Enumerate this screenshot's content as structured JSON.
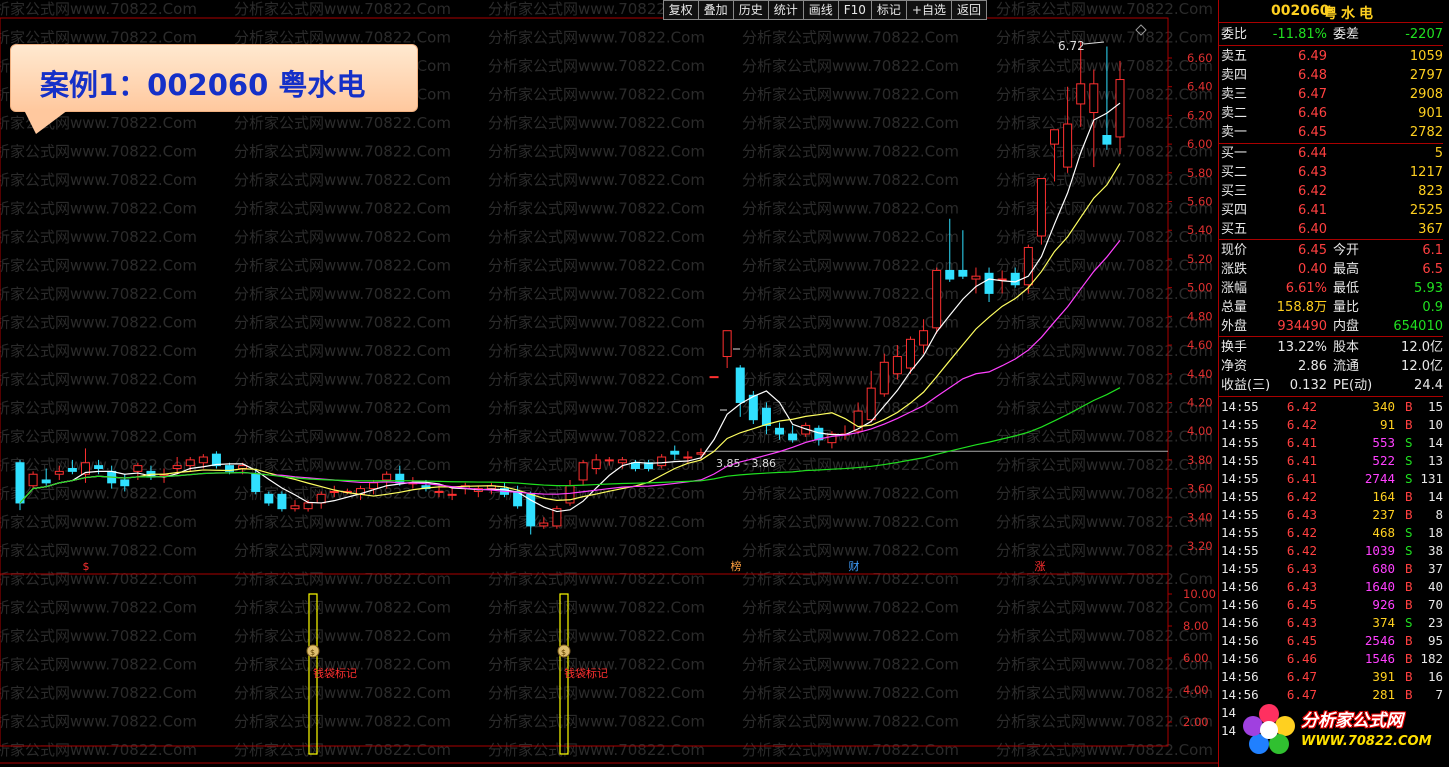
{
  "toolbar": [
    "复权",
    "叠加",
    "历史",
    "统计",
    "画线",
    "F10",
    "标记",
    "+自选",
    "返回"
  ],
  "callout": "案例1：002060 粤水电",
  "watermark": "分析家公式网www.70822.Com",
  "price_axis": [
    "6.60",
    "6.40",
    "6.20",
    "6.00",
    "5.80",
    "5.60",
    "5.40",
    "5.20",
    "5.00",
    "4.80",
    "4.60",
    "4.40",
    "4.20",
    "4.00",
    "3.80",
    "3.60",
    "3.40",
    "3.20"
  ],
  "indicator_axis": [
    "10.00",
    "8.00",
    "6.00",
    "4.00",
    "2.00"
  ],
  "annotations": {
    "high_label": "6.72",
    "range_label": "3.85 - 3.86",
    "event_marks": [
      "$",
      "榜",
      "财",
      "涨"
    ],
    "signal_label_1": "钱袋标记",
    "signal_label_2": "钱袋标记"
  },
  "colors": {
    "up": "#ff3030",
    "down": "#30e0ff",
    "ma5": "#ffffff",
    "ma10": "#ffff60",
    "ma20": "#ff40ff",
    "ma60": "#20e020",
    "signal": "#ffff00"
  },
  "header": {
    "code": "002060",
    "name": "粤水电"
  },
  "quote_top": {
    "label1": "委比",
    "val1": "-11.81%",
    "label2": "委差",
    "val2": "-2207"
  },
  "asks": [
    {
      "label": "卖五",
      "price": "6.49",
      "vol": "1059"
    },
    {
      "label": "卖四",
      "price": "6.48",
      "vol": "2797"
    },
    {
      "label": "卖三",
      "price": "6.47",
      "vol": "2908"
    },
    {
      "label": "卖二",
      "price": "6.46",
      "vol": "901"
    },
    {
      "label": "卖一",
      "price": "6.45",
      "vol": "2782"
    }
  ],
  "bids": [
    {
      "label": "买一",
      "price": "6.44",
      "vol": "5"
    },
    {
      "label": "买二",
      "price": "6.43",
      "vol": "1217"
    },
    {
      "label": "买三",
      "price": "6.42",
      "vol": "823"
    },
    {
      "label": "买四",
      "price": "6.41",
      "vol": "2525"
    },
    {
      "label": "买五",
      "price": "6.40",
      "vol": "367"
    }
  ],
  "stats": [
    {
      "l1": "现价",
      "v1": "6.45",
      "c1": "red",
      "l2": "今开",
      "v2": "6.1",
      "c2": "red"
    },
    {
      "l1": "涨跌",
      "v1": "0.40",
      "c1": "red",
      "l2": "最高",
      "v2": "6.5",
      "c2": "red"
    },
    {
      "l1": "涨幅",
      "v1": "6.61%",
      "c1": "red",
      "l2": "最低",
      "v2": "5.93",
      "c2": "green"
    },
    {
      "l1": "总量",
      "v1": "158.8万",
      "c1": "yellow",
      "l2": "量比",
      "v2": "0.9",
      "c2": "green"
    },
    {
      "l1": "外盘",
      "v1": "934490",
      "c1": "red",
      "l2": "内盘",
      "v2": "654010",
      "c2": "green"
    }
  ],
  "stats2": [
    {
      "l1": "换手",
      "v1": "13.22%",
      "l2": "股本",
      "v2": "12.0亿"
    },
    {
      "l1": "净资",
      "v1": "2.86",
      "l2": "流通",
      "v2": "12.0亿"
    },
    {
      "l1": "收益(三)",
      "v1": "0.132",
      "l2": "PE(动)",
      "v2": "24.4"
    }
  ],
  "ticks": [
    {
      "t": "14:55",
      "p": "6.42",
      "pc": "red",
      "v": "340",
      "vc": "yellow",
      "s": "B",
      "n": "15"
    },
    {
      "t": "14:55",
      "p": "6.42",
      "pc": "red",
      "v": "91",
      "vc": "yellow",
      "s": "B",
      "n": "10"
    },
    {
      "t": "14:55",
      "p": "6.41",
      "pc": "red",
      "v": "553",
      "vc": "magenta",
      "s": "S",
      "n": "14"
    },
    {
      "t": "14:55",
      "p": "6.41",
      "pc": "red",
      "v": "522",
      "vc": "magenta",
      "s": "S",
      "n": "13"
    },
    {
      "t": "14:55",
      "p": "6.41",
      "pc": "red",
      "v": "2744",
      "vc": "magenta",
      "s": "S",
      "n": "131"
    },
    {
      "t": "14:55",
      "p": "6.42",
      "pc": "red",
      "v": "164",
      "vc": "yellow",
      "s": "B",
      "n": "14"
    },
    {
      "t": "14:55",
      "p": "6.43",
      "pc": "red",
      "v": "237",
      "vc": "yellow",
      "s": "B",
      "n": "8"
    },
    {
      "t": "14:55",
      "p": "6.42",
      "pc": "red",
      "v": "468",
      "vc": "yellow",
      "s": "S",
      "n": "18"
    },
    {
      "t": "14:55",
      "p": "6.42",
      "pc": "red",
      "v": "1039",
      "vc": "magenta",
      "s": "S",
      "n": "38"
    },
    {
      "t": "14:55",
      "p": "6.43",
      "pc": "red",
      "v": "680",
      "vc": "magenta",
      "s": "B",
      "n": "37"
    },
    {
      "t": "14:56",
      "p": "6.43",
      "pc": "red",
      "v": "1640",
      "vc": "magenta",
      "s": "B",
      "n": "40"
    },
    {
      "t": "14:56",
      "p": "6.45",
      "pc": "red",
      "v": "926",
      "vc": "magenta",
      "s": "B",
      "n": "70"
    },
    {
      "t": "14:56",
      "p": "6.43",
      "pc": "red",
      "v": "374",
      "vc": "yellow",
      "s": "S",
      "n": "23"
    },
    {
      "t": "14:56",
      "p": "6.45",
      "pc": "red",
      "v": "2546",
      "vc": "magenta",
      "s": "B",
      "n": "95"
    },
    {
      "t": "14:56",
      "p": "6.46",
      "pc": "red",
      "v": "1546",
      "vc": "magenta",
      "s": "B",
      "n": "182"
    },
    {
      "t": "14:56",
      "p": "6.47",
      "pc": "red",
      "v": "391",
      "vc": "yellow",
      "s": "B",
      "n": "16"
    },
    {
      "t": "14:56",
      "p": "6.47",
      "pc": "red",
      "v": "281",
      "vc": "yellow",
      "s": "B",
      "n": "7"
    },
    {
      "t": "14",
      "p": "",
      "pc": "red",
      "v": "",
      "vc": "yellow",
      "s": "",
      "n": ""
    },
    {
      "t": "14",
      "p": "",
      "pc": "red",
      "v": "",
      "vc": "yellow",
      "s": "",
      "n": ""
    }
  ],
  "logo": {
    "text": "分析家公式网",
    "url": "WWW.70822.COM"
  },
  "candles": [
    {
      "o": 3.78,
      "h": 3.8,
      "l": 3.45,
      "c": 3.5
    },
    {
      "o": 3.62,
      "h": 3.72,
      "l": 3.6,
      "c": 3.7
    },
    {
      "o": 3.66,
      "h": 3.74,
      "l": 3.62,
      "c": 3.64
    },
    {
      "o": 3.7,
      "h": 3.76,
      "l": 3.66,
      "c": 3.72
    },
    {
      "o": 3.74,
      "h": 3.8,
      "l": 3.7,
      "c": 3.72
    },
    {
      "o": 3.7,
      "h": 3.88,
      "l": 3.64,
      "c": 3.78
    },
    {
      "o": 3.76,
      "h": 3.8,
      "l": 3.7,
      "c": 3.74
    },
    {
      "o": 3.72,
      "h": 3.76,
      "l": 3.6,
      "c": 3.64
    },
    {
      "o": 3.66,
      "h": 3.7,
      "l": 3.58,
      "c": 3.62
    },
    {
      "o": 3.72,
      "h": 3.78,
      "l": 3.66,
      "c": 3.76
    },
    {
      "o": 3.72,
      "h": 3.76,
      "l": 3.66,
      "c": 3.68
    },
    {
      "o": 3.7,
      "h": 3.74,
      "l": 3.64,
      "c": 3.7
    },
    {
      "o": 3.74,
      "h": 3.82,
      "l": 3.7,
      "c": 3.76
    },
    {
      "o": 3.76,
      "h": 3.82,
      "l": 3.72,
      "c": 3.8
    },
    {
      "o": 3.78,
      "h": 3.84,
      "l": 3.74,
      "c": 3.82
    },
    {
      "o": 3.84,
      "h": 3.86,
      "l": 3.74,
      "c": 3.76
    },
    {
      "o": 3.76,
      "h": 3.78,
      "l": 3.7,
      "c": 3.72
    },
    {
      "o": 3.74,
      "h": 3.78,
      "l": 3.7,
      "c": 3.76
    },
    {
      "o": 3.7,
      "h": 3.74,
      "l": 3.56,
      "c": 3.58
    },
    {
      "o": 3.56,
      "h": 3.58,
      "l": 3.48,
      "c": 3.5
    },
    {
      "o": 3.56,
      "h": 3.58,
      "l": 3.44,
      "c": 3.46
    },
    {
      "o": 3.46,
      "h": 3.52,
      "l": 3.44,
      "c": 3.48
    },
    {
      "o": 3.46,
      "h": 3.52,
      "l": 3.44,
      "c": 3.5
    },
    {
      "o": 3.5,
      "h": 3.58,
      "l": 3.46,
      "c": 3.56
    },
    {
      "o": 3.58,
      "h": 3.62,
      "l": 3.54,
      "c": 3.58
    },
    {
      "o": 3.58,
      "h": 3.6,
      "l": 3.56,
      "c": 3.58
    },
    {
      "o": 3.56,
      "h": 3.62,
      "l": 3.52,
      "c": 3.6
    },
    {
      "o": 3.6,
      "h": 3.66,
      "l": 3.56,
      "c": 3.64
    },
    {
      "o": 3.66,
      "h": 3.72,
      "l": 3.6,
      "c": 3.7
    },
    {
      "o": 3.7,
      "h": 3.76,
      "l": 3.62,
      "c": 3.64
    },
    {
      "o": 3.64,
      "h": 3.68,
      "l": 3.6,
      "c": 3.64
    },
    {
      "o": 3.62,
      "h": 3.66,
      "l": 3.58,
      "c": 3.6
    },
    {
      "o": 3.58,
      "h": 3.62,
      "l": 3.54,
      "c": 3.58
    },
    {
      "o": 3.56,
      "h": 3.6,
      "l": 3.52,
      "c": 3.56
    },
    {
      "o": 3.6,
      "h": 3.64,
      "l": 3.56,
      "c": 3.62
    },
    {
      "o": 3.58,
      "h": 3.62,
      "l": 3.54,
      "c": 3.6
    },
    {
      "o": 3.6,
      "h": 3.64,
      "l": 3.56,
      "c": 3.62
    },
    {
      "o": 3.6,
      "h": 3.64,
      "l": 3.54,
      "c": 3.56
    },
    {
      "o": 3.58,
      "h": 3.62,
      "l": 3.46,
      "c": 3.48
    },
    {
      "o": 3.56,
      "h": 3.58,
      "l": 3.28,
      "c": 3.34
    },
    {
      "o": 3.34,
      "h": 3.4,
      "l": 3.32,
      "c": 3.36
    },
    {
      "o": 3.34,
      "h": 3.48,
      "l": 3.32,
      "c": 3.46
    },
    {
      "o": 3.5,
      "h": 3.66,
      "l": 3.48,
      "c": 3.62
    },
    {
      "o": 3.66,
      "h": 3.8,
      "l": 3.62,
      "c": 3.78
    },
    {
      "o": 3.74,
      "h": 3.84,
      "l": 3.7,
      "c": 3.8
    },
    {
      "o": 3.8,
      "h": 3.82,
      "l": 3.76,
      "c": 3.8
    },
    {
      "o": 3.78,
      "h": 3.82,
      "l": 3.74,
      "c": 3.8
    },
    {
      "o": 3.78,
      "h": 3.8,
      "l": 3.72,
      "c": 3.74
    },
    {
      "o": 3.78,
      "h": 3.8,
      "l": 3.72,
      "c": 3.74
    },
    {
      "o": 3.76,
      "h": 3.84,
      "l": 3.74,
      "c": 3.82
    },
    {
      "o": 3.86,
      "h": 3.9,
      "l": 3.8,
      "c": 3.84
    },
    {
      "o": 3.82,
      "h": 3.86,
      "l": 3.78,
      "c": 3.82
    },
    {
      "o": 3.84,
      "h": 3.88,
      "l": 3.8,
      "c": 3.85
    },
    {
      "o": 4.38,
      "h": 4.38,
      "l": 4.38,
      "c": 4.38
    },
    {
      "o": 4.52,
      "h": 4.7,
      "l": 4.44,
      "c": 4.7
    },
    {
      "o": 4.44,
      "h": 4.46,
      "l": 4.1,
      "c": 4.2
    },
    {
      "o": 4.25,
      "h": 4.28,
      "l": 4.05,
      "c": 4.08
    },
    {
      "o": 4.16,
      "h": 4.2,
      "l": 3.98,
      "c": 4.04
    },
    {
      "o": 4.02,
      "h": 4.06,
      "l": 3.94,
      "c": 3.98
    },
    {
      "o": 3.98,
      "h": 4.04,
      "l": 3.92,
      "c": 3.94
    },
    {
      "o": 3.98,
      "h": 4.06,
      "l": 3.96,
      "c": 4.04
    },
    {
      "o": 4.02,
      "h": 4.04,
      "l": 3.9,
      "c": 3.94
    },
    {
      "o": 3.92,
      "h": 4.0,
      "l": 3.88,
      "c": 3.98
    },
    {
      "o": 3.98,
      "h": 4.04,
      "l": 3.94,
      "c": 3.98
    },
    {
      "o": 4.0,
      "h": 4.2,
      "l": 3.98,
      "c": 4.14
    },
    {
      "o": 4.08,
      "h": 4.42,
      "l": 4.06,
      "c": 4.3
    },
    {
      "o": 4.26,
      "h": 4.54,
      "l": 4.24,
      "c": 4.48
    },
    {
      "o": 4.4,
      "h": 4.6,
      "l": 4.36,
      "c": 4.52
    },
    {
      "o": 4.44,
      "h": 4.66,
      "l": 4.4,
      "c": 4.64
    },
    {
      "o": 4.6,
      "h": 4.78,
      "l": 4.54,
      "c": 4.7
    },
    {
      "o": 4.72,
      "h": 5.14,
      "l": 4.68,
      "c": 5.12
    },
    {
      "o": 5.12,
      "h": 5.48,
      "l": 5.04,
      "c": 5.06
    },
    {
      "o": 5.12,
      "h": 5.4,
      "l": 5.06,
      "c": 5.08
    },
    {
      "o": 5.06,
      "h": 5.14,
      "l": 4.96,
      "c": 5.08
    },
    {
      "o": 5.1,
      "h": 5.14,
      "l": 4.9,
      "c": 4.96
    },
    {
      "o": 5.06,
      "h": 5.12,
      "l": 4.96,
      "c": 5.06
    },
    {
      "o": 5.1,
      "h": 5.14,
      "l": 5.0,
      "c": 5.02
    },
    {
      "o": 5.02,
      "h": 5.3,
      "l": 4.96,
      "c": 5.28
    },
    {
      "o": 5.36,
      "h": 5.76,
      "l": 5.3,
      "c": 5.76
    },
    {
      "o": 6.0,
      "h": 6.1,
      "l": 5.74,
      "c": 6.1
    },
    {
      "o": 5.84,
      "h": 6.4,
      "l": 5.8,
      "c": 6.14
    },
    {
      "o": 6.28,
      "h": 6.72,
      "l": 6.12,
      "c": 6.42
    },
    {
      "o": 6.22,
      "h": 6.52,
      "l": 5.84,
      "c": 6.42
    },
    {
      "o": 6.06,
      "h": 6.68,
      "l": 5.96,
      "c": 6.0
    },
    {
      "o": 6.05,
      "h": 6.58,
      "l": 5.93,
      "c": 6.45
    }
  ]
}
